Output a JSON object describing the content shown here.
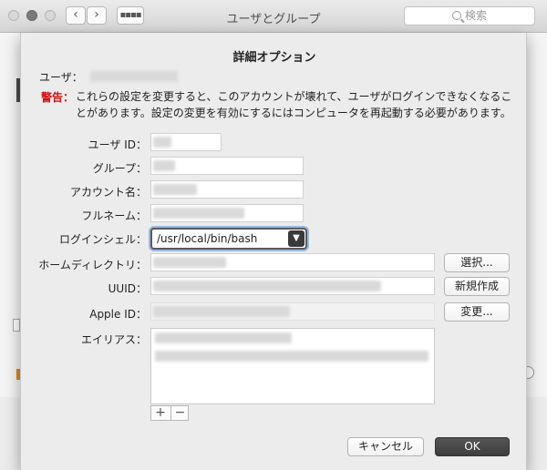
{
  "window": {
    "title": "ユーザとグループ",
    "search_placeholder": "検索",
    "nav_back": "‹",
    "nav_forward": "›",
    "grid_glyph": "▪▪▪▪"
  },
  "sheet": {
    "title": "詳細オプション",
    "user_label": "ユーザ：",
    "warning_label": "警告：",
    "warning_text": "これらの設定を変更すると、このアカウントが壊れて、ユーザがログインできなくなることがあります。設定の変更を有効にするにはコンピュータを再起動する必要があります。",
    "fields": {
      "user_id_label": "ユーザ ID：",
      "group_label": "グループ：",
      "account_name_label": "アカウント名：",
      "full_name_label": "フルネーム：",
      "login_shell_label": "ログインシェル：",
      "home_dir_label": "ホームディレクトリ：",
      "uuid_label": "UUID：",
      "apple_id_label": "Apple ID：",
      "alias_label": "エイリアス："
    },
    "login_shell_value": "/usr/local/bin/bash",
    "buttons": {
      "choose": "選択...",
      "create_new": "新規作成",
      "change": "変更...",
      "cancel": "キャンセル",
      "ok": "OK",
      "add": "+",
      "remove": "−"
    }
  }
}
